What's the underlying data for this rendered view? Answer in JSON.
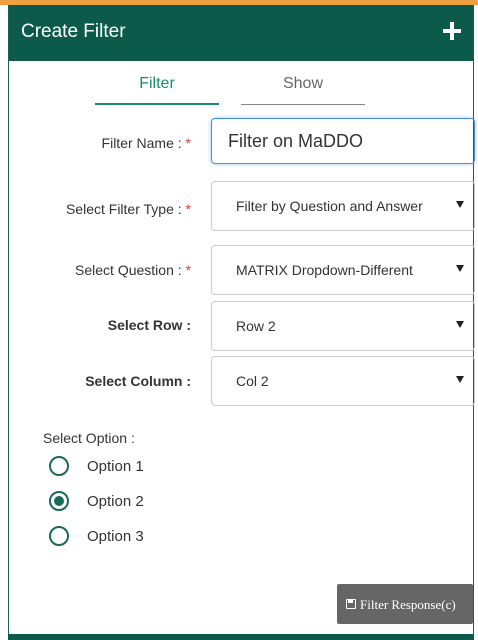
{
  "header": {
    "title": "Create Filter",
    "add_icon": "plus-icon"
  },
  "tabs": [
    {
      "label": "Filter",
      "active": true
    },
    {
      "label": "Show",
      "active": false
    }
  ],
  "form": {
    "filter_name": {
      "label": "Filter Name :",
      "required_mark": "*",
      "value": "Filter on MaDDO"
    },
    "filter_type": {
      "label": "Select Filter Type :",
      "required_mark": "*",
      "value": "Filter by Question and Answer"
    },
    "question": {
      "label": "Select Question :",
      "required_mark": "*",
      "value": "MATRIX Dropdown-Different"
    },
    "row": {
      "label": "Select Row :",
      "value": "Row 2"
    },
    "column": {
      "label": "Select Column :",
      "value": "Col 2"
    }
  },
  "options": {
    "heading": "Select Option :",
    "items": [
      {
        "label": "Option 1",
        "checked": false
      },
      {
        "label": "Option 2",
        "checked": true
      },
      {
        "label": "Option 3",
        "checked": false
      }
    ]
  },
  "actions": {
    "filter_response_label": "Filter Response(c)",
    "icon": "save-icon"
  },
  "colors": {
    "header_bg": "#0c5a4a",
    "accent": "#1a8a72",
    "required": "#e53935",
    "button_bg": "#666666",
    "top_strip": "#f0a040"
  }
}
